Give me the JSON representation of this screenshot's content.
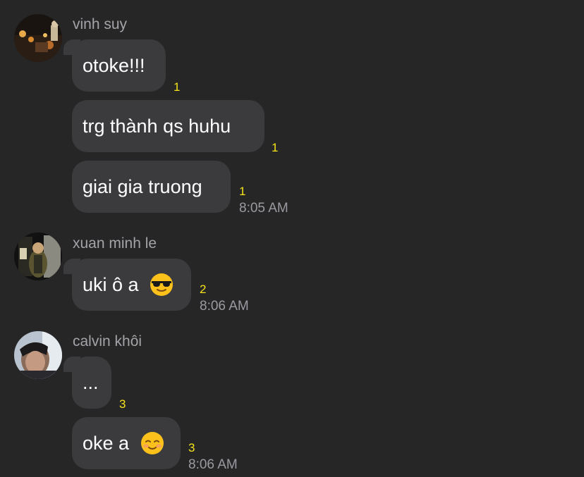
{
  "messages": [
    {
      "sender": "vinh suy",
      "bubbles": [
        {
          "text": "otoke!!!",
          "count": "1"
        },
        {
          "text": "trg thành qs huhu",
          "count": "1"
        },
        {
          "text": "giai gia truong",
          "count": "1",
          "time": "8:05 AM"
        }
      ]
    },
    {
      "sender": "xuan minh le",
      "bubbles": [
        {
          "text": "uki ô a",
          "emoji": "sunglasses-emoji",
          "count": "2",
          "time": "8:06 AM"
        }
      ]
    },
    {
      "sender": "calvin khôi",
      "bubbles": [
        {
          "text": "...",
          "count": "3"
        },
        {
          "text": "oke a",
          "emoji": "smiling-blush-emoji",
          "count": "3",
          "time": "8:06 AM"
        }
      ]
    }
  ],
  "colors": {
    "background": "#262627",
    "bubble": "#3b3b3e",
    "sender_name": "#a3a3a8",
    "reaction_count": "#f5e21a",
    "timestamp": "#9a9aa0"
  }
}
